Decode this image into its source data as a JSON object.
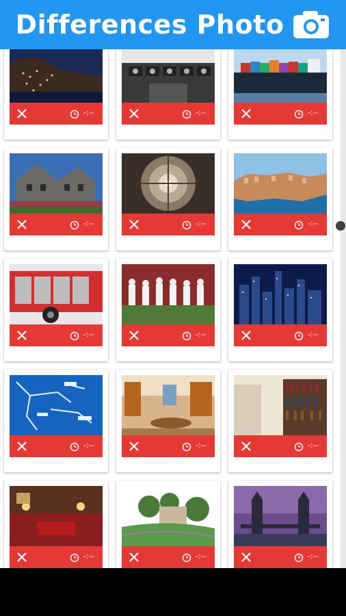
{
  "header": {
    "title": "Differences Photo",
    "icon": "camera-icon"
  },
  "colors": {
    "header": "#2196f3",
    "bar": "#e53935",
    "nav": "#000000"
  },
  "tiles": [
    {
      "name": "coastal-village-night",
      "time": "-:--"
    },
    {
      "name": "cockpit",
      "time": "-:--"
    },
    {
      "name": "cargo-ship",
      "time": "-:--"
    },
    {
      "name": "victorian-house",
      "time": "-:--"
    },
    {
      "name": "cathedral-dome",
      "time": "-:--"
    },
    {
      "name": "dubrovnik",
      "time": "-:--"
    },
    {
      "name": "fire-truck",
      "time": "-:--"
    },
    {
      "name": "football-players",
      "time": "-:--"
    },
    {
      "name": "city-night-skyline",
      "time": "-:--"
    },
    {
      "name": "blue-map",
      "time": "-:--"
    },
    {
      "name": "kitchen",
      "time": "-:--"
    },
    {
      "name": "library",
      "time": "-:--"
    },
    {
      "name": "living-room",
      "time": "-:--"
    },
    {
      "name": "garden-houses",
      "time": "-:--"
    },
    {
      "name": "tower-bridge",
      "time": "-:--"
    }
  ]
}
